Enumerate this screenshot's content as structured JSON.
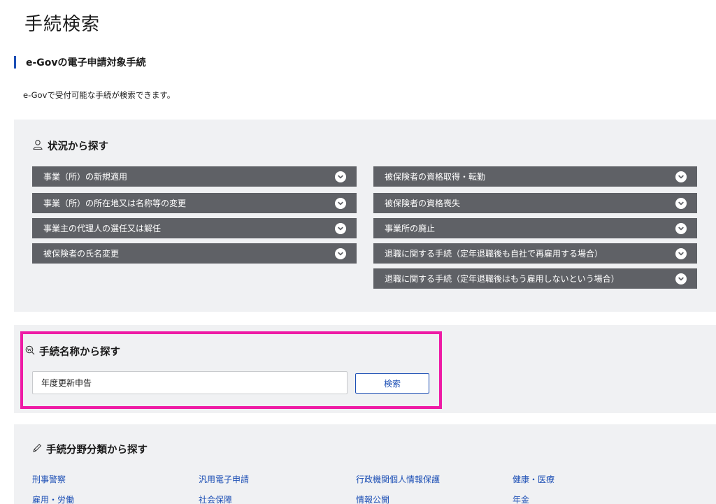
{
  "page": {
    "title": "手続検索",
    "section_heading": "e-Govの電子申請対象手続",
    "description": "e-Govで受付可能な手続が検索できます。"
  },
  "situation": {
    "title": "状況から探す",
    "icon": "person-icon",
    "left_items": [
      "事業（所）の新規適用",
      "事業（所）の所在地又は名称等の変更",
      "事業主の代理人の選任又は解任",
      "被保険者の氏名変更"
    ],
    "right_items": [
      "被保険者の資格取得・転勤",
      "被保険者の資格喪失",
      "事業所の廃止",
      "退職に関する手続（定年退職後も自社で再雇用する場合）",
      "退職に関する手続（定年退職後はもう雇用しないという場合）"
    ]
  },
  "name_search": {
    "title": "手続名称から探す",
    "icon": "word-search-icon",
    "input_value": "年度更新申告",
    "button_label": "検索",
    "highlight_color": "#ee1ba5"
  },
  "category": {
    "title": "手続分野分類から探す",
    "icon": "pencil-icon",
    "rows": [
      [
        "刑事警察",
        "汎用電子申請",
        "行政機関個人情報保護",
        "健康・医療"
      ],
      [
        "雇用・労働",
        "社会保障",
        "情報公開",
        "年金"
      ]
    ]
  },
  "colors": {
    "accent": "#1c4fb5",
    "panel_bg": "#f0f1f3",
    "accordion_bg": "#5f6166",
    "highlight": "#ee1ba5"
  }
}
